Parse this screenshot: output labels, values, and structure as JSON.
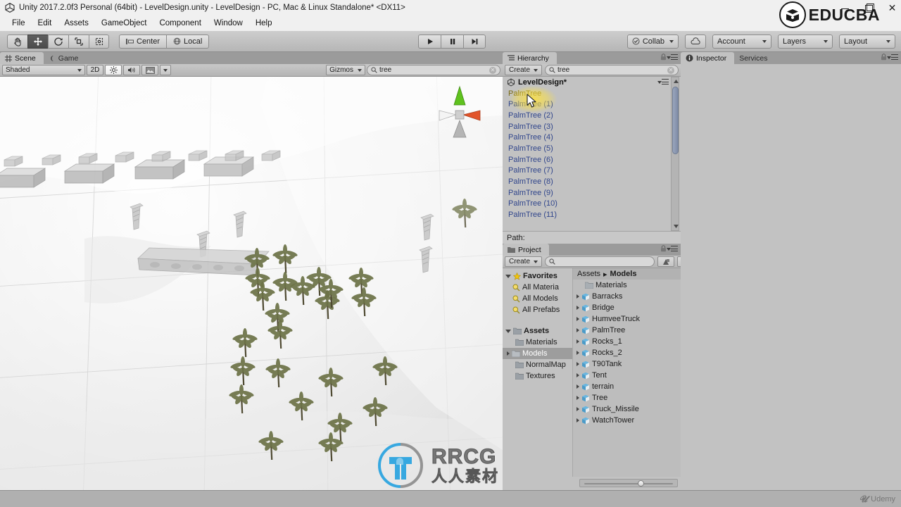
{
  "window": {
    "title": "Unity 2017.2.0f3 Personal (64bit) - LevelDesign.unity - LevelDesign - PC, Mac & Linux Standalone* <DX11>",
    "app_icon": "unity-icon",
    "minimize": "minimize-icon",
    "maximize": "maximize-icon",
    "close": "close-icon"
  },
  "watermarks": {
    "educba": "EDUCBA",
    "rrcg_top": "RRCG",
    "rrcg_bottom": "人人素材",
    "udemy": "Udemy"
  },
  "menu": {
    "items": [
      "File",
      "Edit",
      "Assets",
      "GameObject",
      "Component",
      "Window",
      "Help"
    ]
  },
  "toolbar": {
    "transform_tools": [
      {
        "name": "hand-tool",
        "icon": "hand-icon",
        "active": false
      },
      {
        "name": "move-tool",
        "icon": "move-icon",
        "active": true
      },
      {
        "name": "rotate-tool",
        "icon": "rotate-icon",
        "active": false
      },
      {
        "name": "scale-tool",
        "icon": "scale-icon",
        "active": false
      },
      {
        "name": "rect-tool",
        "icon": "rect-icon",
        "active": false
      }
    ],
    "pivot_label": "Center",
    "space_label": "Local",
    "play": "play-icon",
    "pause": "pause-icon",
    "step": "step-icon",
    "collab_label": "Collab",
    "cloud_label": "cloud-icon",
    "account_label": "Account",
    "layers_label": "Layers",
    "layout_label": "Layout"
  },
  "scene": {
    "tabs": [
      {
        "label": "Scene",
        "icon": "grid-icon",
        "selected": true
      },
      {
        "label": "Game",
        "icon": "gamepad-icon",
        "selected": false
      }
    ],
    "shading_mode": "Shaded",
    "mode_2d": "2D",
    "lighting_icon": "sun-icon",
    "audio_icon": "speaker-icon",
    "effects_icon": "image-icon",
    "gizmos_label": "Gizmos",
    "search_value": "tree",
    "search_placeholder": "",
    "gizmo_axes": [
      "x-axis-cone",
      "y-axis-cone",
      "z-axis-cone"
    ]
  },
  "hierarchy": {
    "tab_label": "Hierarchy",
    "tab_icon": "hierarchy-icon",
    "create_label": "Create",
    "search_value": "tree",
    "root": "LevelDesign*",
    "items": [
      "PalmTree",
      "PalmTree (1)",
      "PalmTree (2)",
      "PalmTree (3)",
      "PalmTree (4)",
      "PalmTree (5)",
      "PalmTree (6)",
      "PalmTree (7)",
      "PalmTree (8)",
      "PalmTree (9)",
      "PalmTree (10)",
      "PalmTree (11)"
    ],
    "hovered_index": 0,
    "path_label": "Path:"
  },
  "inspector": {
    "tabs": [
      {
        "label": "Inspector",
        "icon": "info-icon",
        "selected": true
      },
      {
        "label": "Services",
        "icon": "",
        "selected": false
      }
    ]
  },
  "project": {
    "tab_label": "Project",
    "tab_icon": "folder-icon",
    "create_label": "Create",
    "search_value": "",
    "search_placeholder": "",
    "toolbar_icons": [
      "filter-type-icon",
      "filter-label-icon",
      "favorite-star-icon"
    ],
    "favorites": {
      "label": "Favorites",
      "items": [
        "All Materia",
        "All Models",
        "All Prefabs"
      ]
    },
    "assets": {
      "label": "Assets",
      "items": [
        {
          "label": "Materials",
          "selected": false,
          "expandable": false
        },
        {
          "label": "Models",
          "selected": true,
          "expandable": true
        },
        {
          "label": "NormalMap",
          "selected": false,
          "expandable": false
        },
        {
          "label": "Textures",
          "selected": false,
          "expandable": false
        }
      ]
    },
    "breadcrumb": [
      "Assets",
      "Models"
    ],
    "contents": [
      {
        "label": "Materials",
        "kind": "folder",
        "expandable": false
      },
      {
        "label": "Barracks",
        "kind": "model",
        "expandable": true
      },
      {
        "label": "Bridge",
        "kind": "model",
        "expandable": true
      },
      {
        "label": "HumveeTruck",
        "kind": "model",
        "expandable": true
      },
      {
        "label": "PalmTree",
        "kind": "model",
        "expandable": true
      },
      {
        "label": "Rocks_1",
        "kind": "model",
        "expandable": true
      },
      {
        "label": "Rocks_2",
        "kind": "model",
        "expandable": true
      },
      {
        "label": "T90Tank",
        "kind": "model",
        "expandable": true
      },
      {
        "label": "Tent",
        "kind": "model",
        "expandable": true
      },
      {
        "label": "terrain",
        "kind": "model",
        "expandable": true
      },
      {
        "label": "Tree",
        "kind": "model",
        "expandable": true
      },
      {
        "label": "Truck_Missile",
        "kind": "model",
        "expandable": true
      },
      {
        "label": "WatchTower",
        "kind": "model",
        "expandable": true
      }
    ]
  },
  "colors": {
    "chrome": "#c2c2c2",
    "toolbar": "#b6b6b6",
    "hierarchy_item": "#31468c",
    "selection": "#9d9d9d",
    "highlight": "#ffe23c",
    "axis_y": "#5fc21e",
    "axis_x": "#e2542a"
  }
}
